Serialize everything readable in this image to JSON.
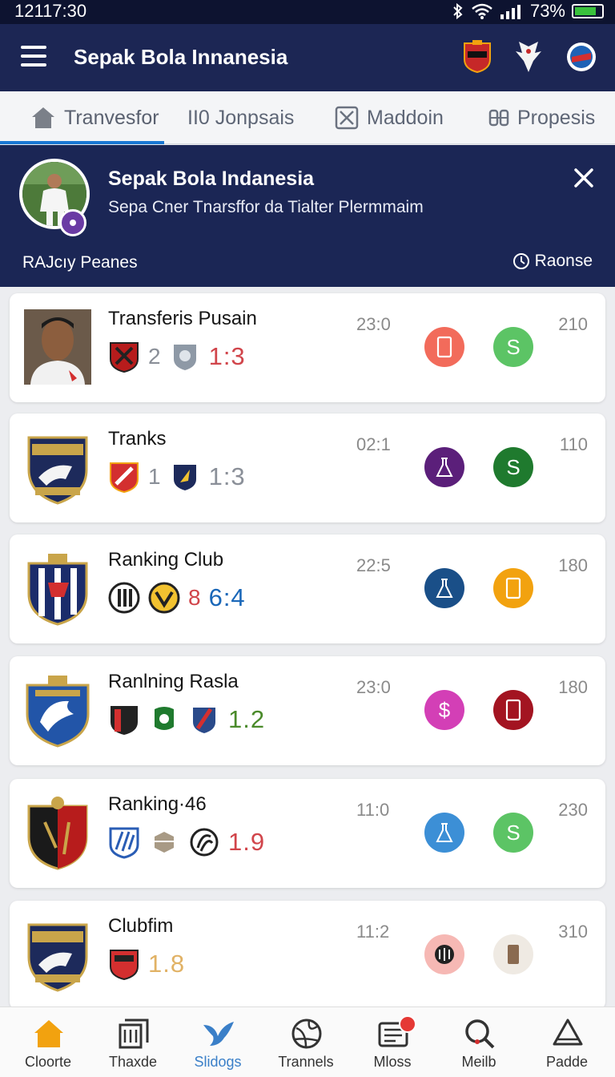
{
  "status": {
    "time": "12117:30",
    "battery": "73%",
    "battery_level": 0.73
  },
  "appbar": {
    "title": "Sepak Bola Innanesia"
  },
  "tabs": [
    {
      "label": "Tranvesfor",
      "icon": "home-icon"
    },
    {
      "label": "II0 Jonpsais",
      "icon": "none"
    },
    {
      "label": "Maddoin",
      "icon": "box-x-icon"
    },
    {
      "label": "Propesis",
      "icon": "grid-icon"
    }
  ],
  "hero": {
    "title": "Sepak Bola Indanesia",
    "subtitle": "Sepa Cner Tnarsffor da Tialter Plermmaim",
    "left_label": "RAJcıy  Peanes",
    "right_label": "Raonse"
  },
  "cards": [
    {
      "name": "Transferis Pusain",
      "gnum": "2",
      "score": "1:3",
      "score_color": "#d1454b",
      "time": "23:0",
      "value": "210",
      "circle_a_color": "#f26b5b",
      "circle_a_icon": "phone-icon",
      "circle_b_color": "#5cc465",
      "circle_b_icon": "S"
    },
    {
      "name": "Tranks",
      "gnum": "1",
      "score": "1:3",
      "score_color": "#8a8f98",
      "time": "02:1",
      "value": "110",
      "circle_a_color": "#5b1f7a",
      "circle_a_icon": "flask-icon",
      "circle_b_color": "#1f7a2e",
      "circle_b_icon": "S"
    },
    {
      "name": "Ranking Club",
      "gnum": "8",
      "score": "6:4",
      "score_color": "#1a67b8",
      "time": "22:5",
      "value": "180",
      "circle_a_color": "#1a4f88",
      "circle_a_icon": "flask-icon",
      "circle_b_color": "#f2a20f",
      "circle_b_icon": "phone-icon"
    },
    {
      "name": "Ranlning Rasla",
      "gnum": "",
      "score": "1.2",
      "score_color": "#4a8a2a",
      "time": "23:0",
      "value": "180",
      "circle_a_color": "#d33fb6",
      "circle_a_icon": "$",
      "circle_b_color": "#a31421",
      "circle_b_icon": "phone-icon"
    },
    {
      "name": "Ranking·46",
      "gnum": "",
      "score": "1.9",
      "score_color": "#d1454b",
      "time": "11:0",
      "value": "230",
      "circle_a_color": "#3c8fd6",
      "circle_a_icon": "flask-icon",
      "circle_b_color": "#5cc465",
      "circle_b_icon": "S"
    },
    {
      "name": "Clubfim",
      "gnum": "",
      "score": "1.8",
      "score_color": "#e1b265",
      "time": "11:2",
      "value": "310",
      "circle_a_color": "#f6b8b4",
      "circle_a_icon": "ball-icon",
      "circle_b_color": "#efeae3",
      "circle_b_icon": "phone-icon"
    }
  ],
  "nav": [
    {
      "label": "Cloorte",
      "icon": "home-icon",
      "color": "#f2a20f"
    },
    {
      "label": "Thaxde",
      "icon": "stack-icon",
      "color": "#333333"
    },
    {
      "label": "Slidogs",
      "icon": "bird-icon",
      "color": "#3a7fc8"
    },
    {
      "label": "Trannels",
      "icon": "ball-icon",
      "color": "#333333"
    },
    {
      "label": "Mloss",
      "icon": "message-icon",
      "color": "#333333"
    },
    {
      "label": "Meilb",
      "icon": "search-icon",
      "color": "#333333"
    },
    {
      "label": "Padde",
      "icon": "flask-icon",
      "color": "#333333"
    }
  ]
}
